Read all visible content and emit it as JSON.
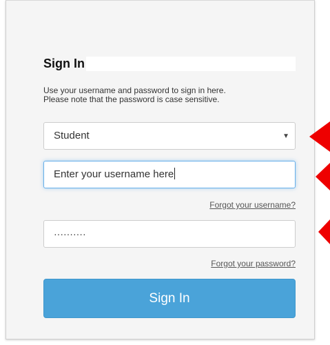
{
  "form": {
    "title": "Sign In",
    "instructions": [
      "Use your username and password to sign in here.",
      "Please note that the password is case sensitive."
    ],
    "role_select": {
      "value": "Student",
      "caret": "▼"
    },
    "username": {
      "value": "Enter your username here"
    },
    "forgot_username": "Forgot your username?",
    "password": {
      "masked_value": "··········"
    },
    "forgot_password": "Forgot your password?",
    "submit_label": "Sign In"
  },
  "annotations": {
    "arrow_color": "#ee0000",
    "arrow_count": 3
  },
  "colors": {
    "button": "#4aa3d9",
    "focus_border": "#66afe9",
    "panel_background": "#f5f5f5"
  }
}
